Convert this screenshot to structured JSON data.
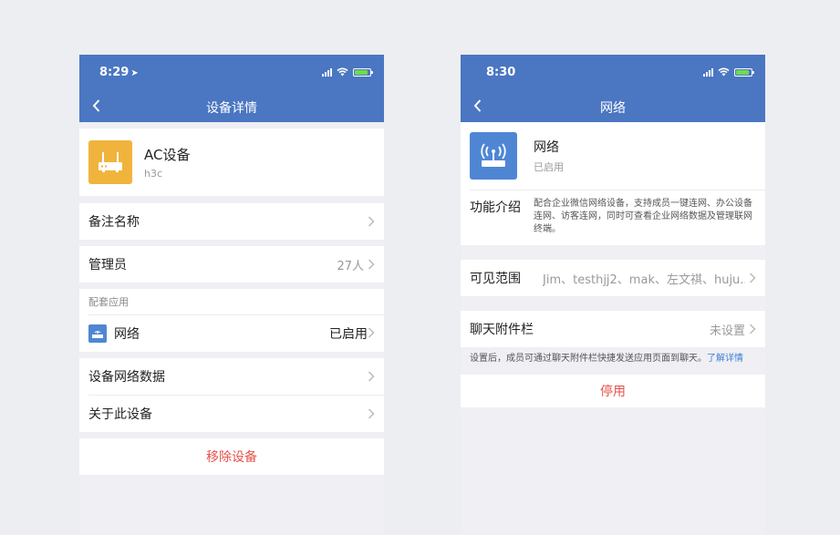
{
  "left_phone": {
    "status": {
      "time": "8:29"
    },
    "nav": {
      "title": "设备详情"
    },
    "device": {
      "name": "AC设备",
      "model": "h3c"
    },
    "rows": {
      "remark_label": "备注名称",
      "admin_label": "管理员",
      "admin_count": "27人",
      "section_label": "配套应用",
      "app_label": "网络",
      "app_status": "已启用",
      "network_data_label": "设备网络数据",
      "about_label": "关于此设备"
    },
    "remove_label": "移除设备"
  },
  "right_phone": {
    "status": {
      "time": "8:30"
    },
    "nav": {
      "title": "网络"
    },
    "app": {
      "name": "网络",
      "status": "已启用"
    },
    "intro": {
      "label": "功能介绍",
      "text": "配合企业微信网络设备，支持成员一键连网、办公设备连网、访客连网，同时可查看企业网络数据及管理联网终端。"
    },
    "visible": {
      "label": "可见范围",
      "value": "Jim、testhjj2、mak、左文祺、huju..."
    },
    "chat_bar": {
      "label": "聊天附件栏",
      "value": "未设置"
    },
    "note": {
      "text": "设置后，成员可通过聊天附件栏快捷发送应用页面到聊天。",
      "link": "了解详情"
    },
    "disable_label": "停用"
  },
  "colors": {
    "header": "#4a76c2",
    "danger": "#e5524a",
    "device_icon": "#f0b43c",
    "app_icon": "#4f86d4"
  },
  "icons": [
    "location-arrow-icon",
    "signal-icon",
    "wifi-icon",
    "battery-icon",
    "back-icon",
    "router-icon",
    "chevron-right-icon",
    "network-app-icon"
  ]
}
